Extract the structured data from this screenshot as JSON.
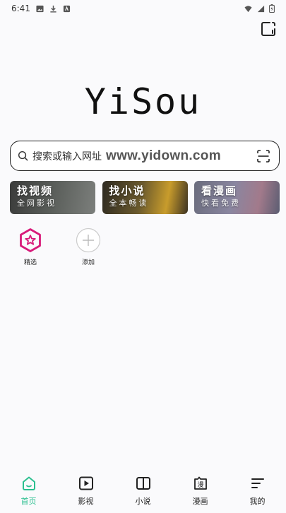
{
  "status_bar": {
    "time": "6:41"
  },
  "logo_text": "YiSou",
  "search": {
    "placeholder": "搜索或输入网址",
    "watermark": "www.yidown.com"
  },
  "cards": [
    {
      "title": "找视频",
      "subtitle": "全网影视"
    },
    {
      "title": "找小说",
      "subtitle": "全本畅读"
    },
    {
      "title": "看漫画",
      "subtitle": "快看免费"
    }
  ],
  "shortcuts": [
    {
      "label": "精选",
      "icon": "star-hexagon-icon",
      "color": "#d81b7a"
    },
    {
      "label": "添加",
      "icon": "plus-circle-icon"
    }
  ],
  "bottom_nav": [
    {
      "label": "首页",
      "icon": "home-icon",
      "active": true
    },
    {
      "label": "影视",
      "icon": "play-icon"
    },
    {
      "label": "小说",
      "icon": "book-icon"
    },
    {
      "label": "漫画",
      "icon": "comic-icon",
      "glyph": "漫"
    },
    {
      "label": "我的",
      "icon": "menu-lines-icon"
    }
  ],
  "colors": {
    "accent": "#2bbf8f",
    "featured": "#d81b7a"
  }
}
